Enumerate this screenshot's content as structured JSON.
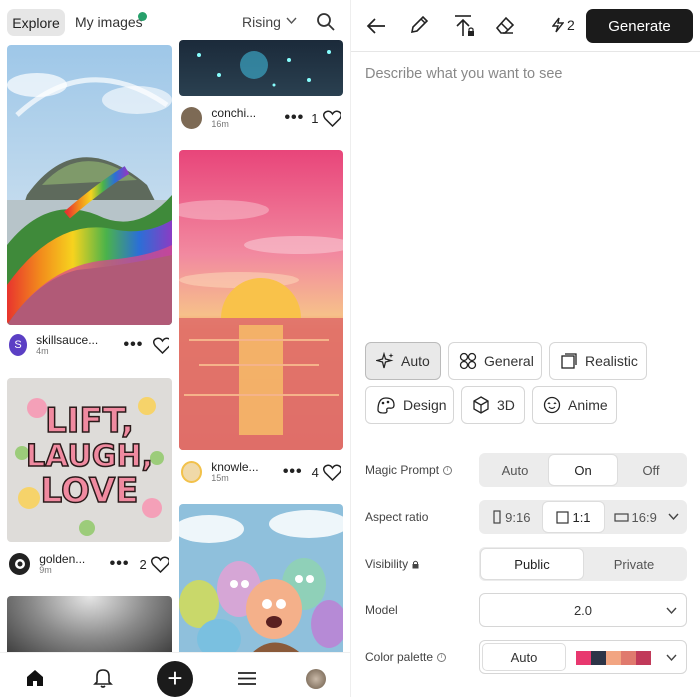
{
  "left": {
    "tabs": {
      "explore": "Explore",
      "my_images": "My images"
    },
    "sort": "Rising",
    "cards": [
      {
        "user": "skillsauce...",
        "time": "4m",
        "avatar_letter": "S",
        "avatar_color": "#5b3fc4"
      },
      {
        "user": "golden...",
        "time": "9m",
        "likes": "2"
      },
      {
        "user": "conchi...",
        "time": "16m",
        "likes": "1"
      },
      {
        "user": "knowle...",
        "time": "15m",
        "likes": "4"
      }
    ],
    "lift_poster": {
      "line1": "LIFT,",
      "line2": "LAUGH,",
      "line3": "LOVE"
    }
  },
  "right": {
    "credits": "2",
    "generate_label": "Generate",
    "prompt_placeholder": "Describe what you want to see",
    "styles": [
      {
        "label": "Auto",
        "icon": "sparkle-icon",
        "active": true
      },
      {
        "label": "General",
        "icon": "grid-icon"
      },
      {
        "label": "Realistic",
        "icon": "photo-icon"
      },
      {
        "label": "Design",
        "icon": "palette-icon"
      },
      {
        "label": "3D",
        "icon": "cube-icon"
      },
      {
        "label": "Anime",
        "icon": "face-icon"
      }
    ],
    "magic_prompt": {
      "label": "Magic Prompt",
      "options": [
        "Auto",
        "On",
        "Off"
      ],
      "selected": "On"
    },
    "aspect_ratio": {
      "label": "Aspect ratio",
      "options": [
        "9:16",
        "1:1",
        "16:9"
      ],
      "selected": "1:1"
    },
    "visibility": {
      "label": "Visibility",
      "options": [
        "Public",
        "Private"
      ],
      "selected": "Public"
    },
    "model": {
      "label": "Model",
      "value": "2.0"
    },
    "color_palette": {
      "label": "Color palette",
      "value": "Auto",
      "swatches": [
        "#e8386f",
        "#2d3447",
        "#f2a582",
        "#e07a6e",
        "#c13a5a"
      ]
    }
  }
}
